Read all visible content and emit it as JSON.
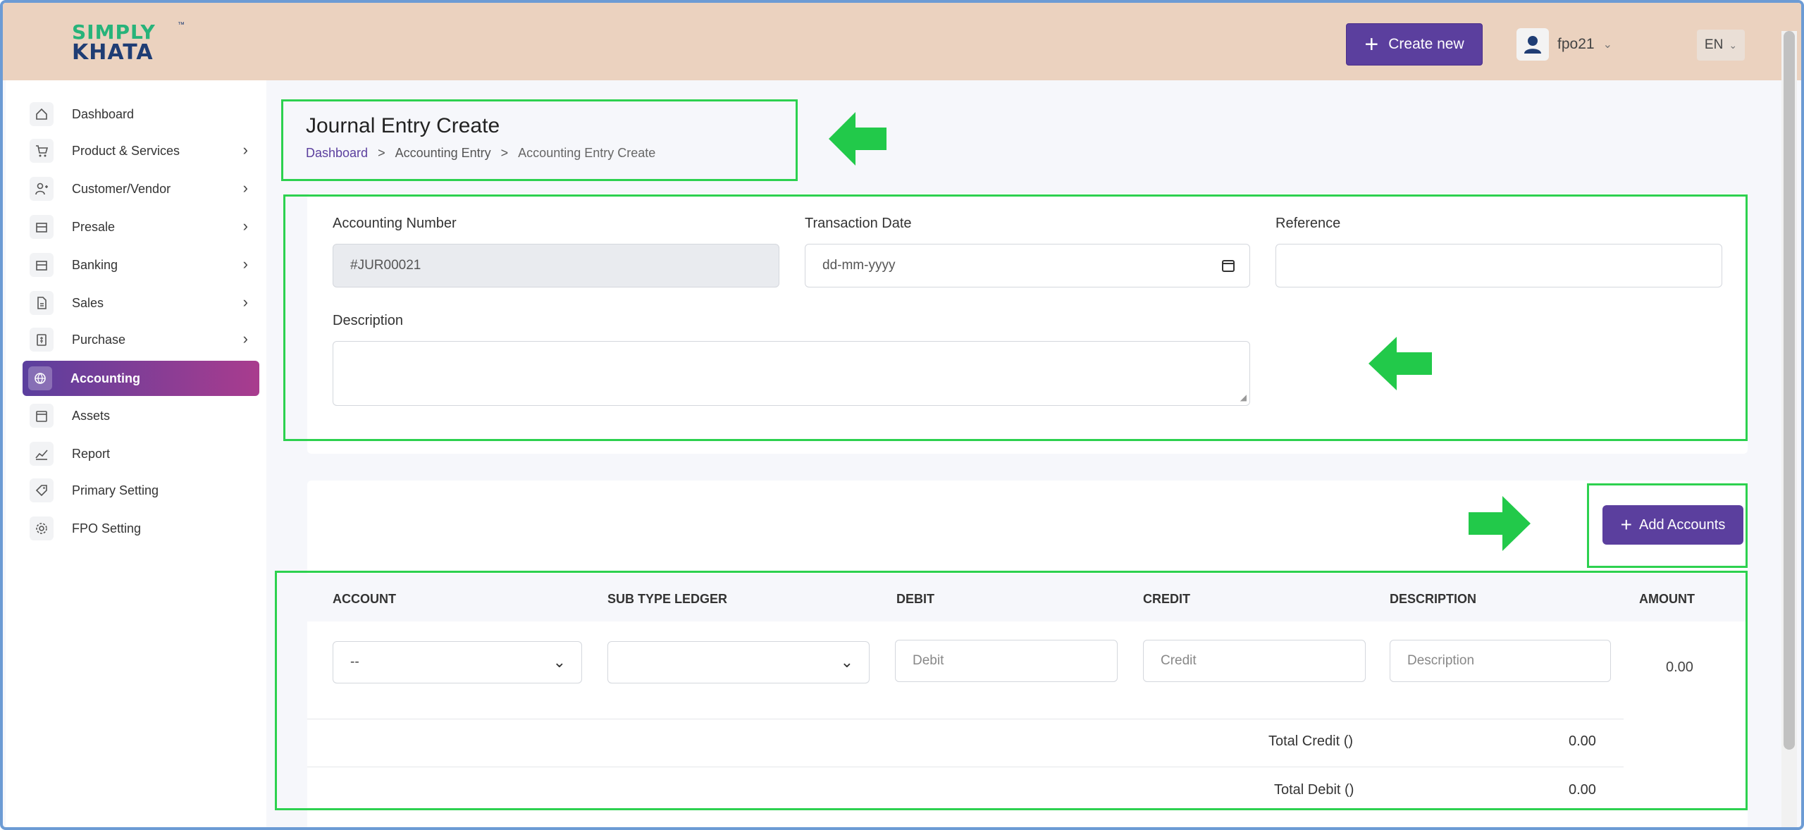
{
  "header": {
    "logo_line1": "SIMPLY",
    "logo_line2": "KHATA",
    "create_label": "Create new",
    "user_name": "fpo21",
    "language": "EN"
  },
  "sidebar": {
    "items": [
      {
        "label": "Dashboard",
        "icon": "home-icon",
        "has_chevron": false
      },
      {
        "label": "Product & Services",
        "icon": "cart-icon",
        "has_chevron": true
      },
      {
        "label": "Customer/Vendor",
        "icon": "user-plus-icon",
        "has_chevron": true
      },
      {
        "label": "Presale",
        "icon": "box-icon",
        "has_chevron": true
      },
      {
        "label": "Banking",
        "icon": "bank-icon",
        "has_chevron": true
      },
      {
        "label": "Sales",
        "icon": "document-icon",
        "has_chevron": true
      },
      {
        "label": "Purchase",
        "icon": "receipt-icon",
        "has_chevron": true
      },
      {
        "label": "Accounting",
        "icon": "globe-icon",
        "has_chevron": false,
        "active": true
      },
      {
        "label": "Assets",
        "icon": "calendar-icon",
        "has_chevron": false
      },
      {
        "label": "Report",
        "icon": "chart-icon",
        "has_chevron": false
      },
      {
        "label": "Primary Setting",
        "icon": "tag-icon",
        "has_chevron": false
      },
      {
        "label": "FPO Setting",
        "icon": "gear-icon",
        "has_chevron": false
      }
    ]
  },
  "page": {
    "title": "Journal Entry Create",
    "breadcrumb": [
      "Dashboard",
      "Accounting Entry",
      "Accounting Entry Create"
    ],
    "breadcrumb_sep": ">"
  },
  "form": {
    "accounting_number_label": "Accounting Number",
    "accounting_number_value": "#JUR00021",
    "transaction_date_label": "Transaction Date",
    "transaction_date_placeholder": "dd-mm-yyyy",
    "reference_label": "Reference",
    "reference_value": "",
    "description_label": "Description",
    "description_value": ""
  },
  "accounts": {
    "add_label": "Add Accounts",
    "columns": [
      "ACCOUNT",
      "SUB TYPE LEDGER",
      "DEBIT",
      "CREDIT",
      "DESCRIPTION",
      "AMOUNT"
    ],
    "row": {
      "account_value": "--",
      "sub_type_value": "",
      "debit_placeholder": "Debit",
      "credit_placeholder": "Credit",
      "description_placeholder": "Description",
      "amount": "0.00"
    },
    "total_credit_label": "Total Credit ()",
    "total_credit_value": "0.00",
    "total_debit_label": "Total Debit ()",
    "total_debit_value": "0.00"
  },
  "colors": {
    "primary": "#5b3f9e",
    "header_bg": "#ebd2bf",
    "highlight": "#2dd14f"
  }
}
